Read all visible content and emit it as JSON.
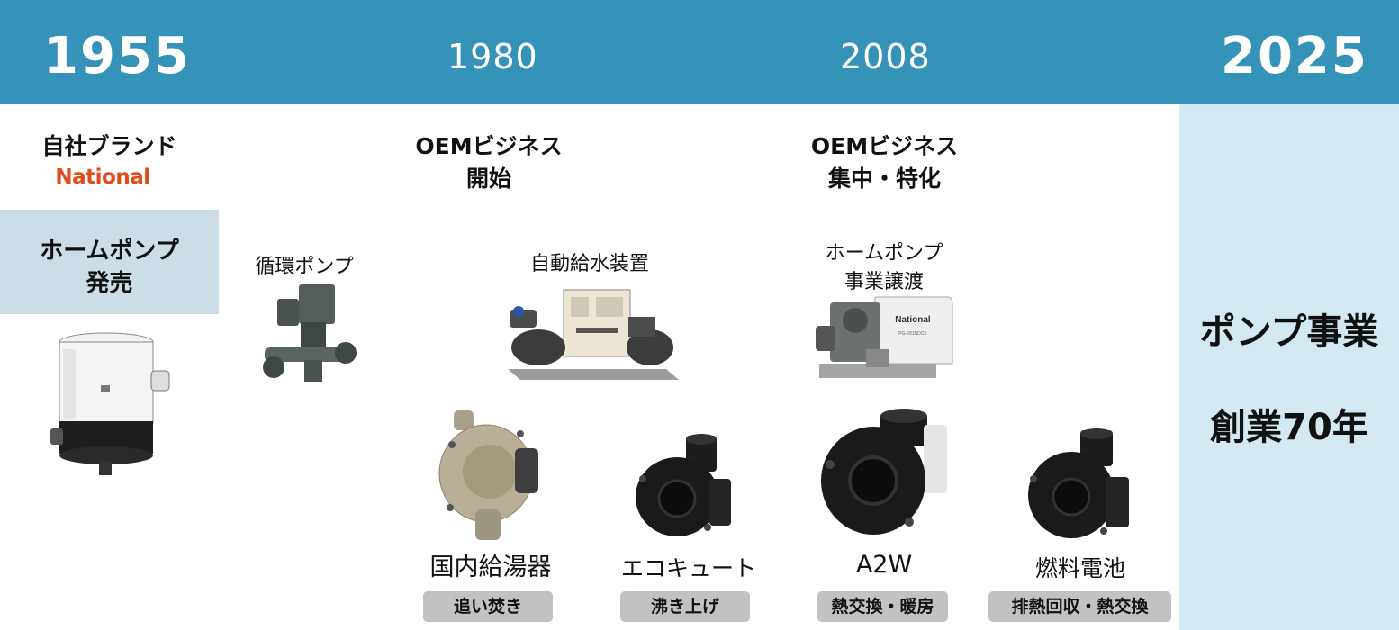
{
  "timeline": {
    "years": [
      "1955",
      "1980",
      "2008",
      "2025"
    ]
  },
  "milestones": {
    "own_brand": {
      "title": "自社ブランド",
      "logo_text": "National"
    },
    "home_pump_launch": {
      "line1": "ホームポンプ",
      "line2": "発売"
    },
    "oem_start": {
      "line1": "OEMビジネス",
      "line2": "開始"
    },
    "oem_focus": {
      "line1": "OEMビジネス",
      "line2": "集中・特化"
    }
  },
  "products": {
    "circulation_pump": "循環ポンプ",
    "auto_water_supply": "自動給水装置",
    "home_pump_transfer": {
      "line1": "ホームポンプ",
      "line2": "事業譲渡"
    },
    "pump_nameplate": {
      "brand": "National",
      "model": "PG-281NDCK"
    },
    "domestic_water_heater": {
      "label": "国内給湯器",
      "tag": "追い焚き"
    },
    "eco_cute": {
      "label": "エコキュート",
      "tag": "沸き上げ"
    },
    "a2w": {
      "label": "A2W",
      "tag": "熱交換・暖房"
    },
    "fuel_cell": {
      "label": "燃料電池",
      "tag": "排熱回収・熱交換"
    }
  },
  "anniversary": {
    "line1": "ポンプ事業",
    "line2": "創業70年"
  },
  "colors": {
    "header": "#3592b9",
    "anniversary_panel": "#d4e8f1",
    "launch_box": "#cddde7",
    "tag_bg": "#c2c2c2",
    "national_logo": "#e04a1c"
  }
}
